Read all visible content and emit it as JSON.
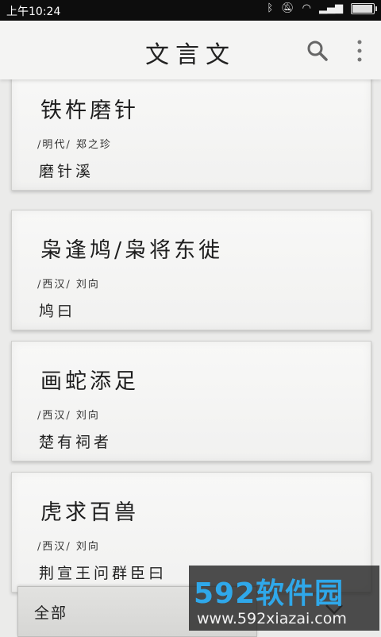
{
  "status_bar": {
    "time": "上午10:24",
    "icons": [
      "bluetooth-icon",
      "mute-icon",
      "wifi-icon",
      "signal-icon",
      "battery-icon"
    ]
  },
  "app_bar": {
    "title": "文言文",
    "search_icon": "search-icon",
    "more_icon": "more-vert-icon"
  },
  "cards": [
    {
      "title": "铁杵磨针",
      "meta": "/明代/ 郑之珍",
      "excerpt": "磨针溪"
    },
    {
      "title": "枭逢鸠/枭将东徙",
      "meta": "/西汉/ 刘向",
      "excerpt": "鸠曰"
    },
    {
      "title": "画蛇添足",
      "meta": "/西汉/ 刘向",
      "excerpt": "楚有祠者"
    },
    {
      "title": "虎求百兽",
      "meta": "/西汉/ 刘向",
      "excerpt": "荆宣王问群臣曰"
    }
  ],
  "bottom_bar": {
    "label": "全部",
    "chevron_icon": "chevron-down-icon"
  },
  "watermark": {
    "brand": "592软件园",
    "url": "www.592xiazai.com"
  },
  "colors": {
    "background": "#ebebea",
    "status_bar": "#0d0d0d",
    "watermark_brand": "#2fa8ea"
  }
}
